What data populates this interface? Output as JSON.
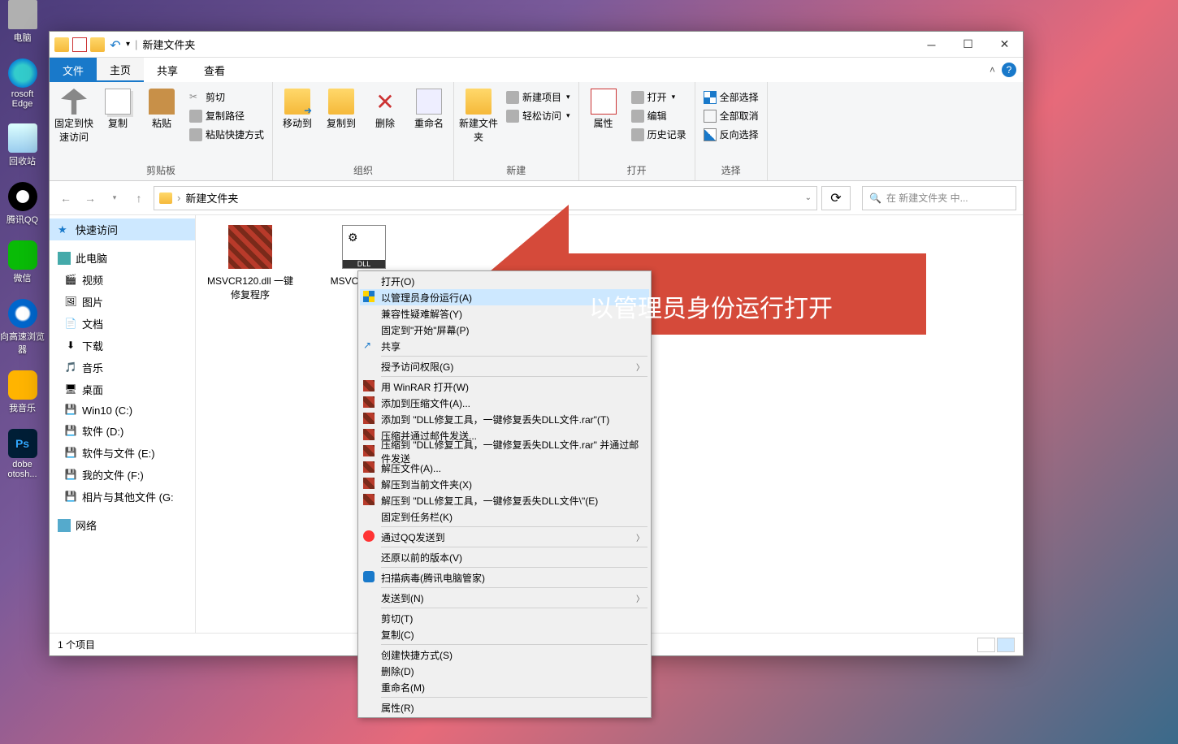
{
  "desktop": {
    "icons": [
      {
        "label": "电脑"
      },
      {
        "label": "rosoft Edge"
      },
      {
        "label": "回收站"
      },
      {
        "label": "腾讯QQ"
      },
      {
        "label": "微信"
      },
      {
        "label": "向高速浏览器"
      },
      {
        "label": "我音乐"
      },
      {
        "label": "dobe otosh..."
      }
    ]
  },
  "window": {
    "title": "新建文件夹",
    "ribbon": {
      "tabs": {
        "file": "文件",
        "home": "主页",
        "share": "共享",
        "view": "查看"
      },
      "clipboard": {
        "label": "剪贴板",
        "pin": "固定到快速访问",
        "copy": "复制",
        "paste": "粘贴",
        "cut": "剪切",
        "copy_path": "复制路径",
        "paste_shortcut": "粘贴快捷方式"
      },
      "organize": {
        "label": "组织",
        "move": "移动到",
        "copy_to": "复制到",
        "delete": "删除",
        "rename": "重命名"
      },
      "new": {
        "label": "新建",
        "new_folder": "新建文件夹",
        "new_item": "新建项目",
        "easy_access": "轻松访问"
      },
      "open": {
        "label": "打开",
        "props": "属性",
        "open": "打开",
        "edit": "编辑",
        "history": "历史记录"
      },
      "select": {
        "label": "选择",
        "all": "全部选择",
        "none": "全部取消",
        "invert": "反向选择"
      }
    },
    "breadcrumb": {
      "root": "",
      "name": "新建文件夹"
    },
    "search_placeholder": "在 新建文件夹 中...",
    "side": {
      "quick": "快速访问",
      "thispc": "此电脑",
      "items": [
        "视频",
        "图片",
        "文档",
        "下载",
        "音乐",
        "桌面",
        "Win10 (C:)",
        "软件 (D:)",
        "软件与文件 (E:)",
        "我的文件 (F:)",
        "相片与其他文件 (G:"
      ],
      "network": "网络"
    },
    "files": [
      {
        "name": "MSVCR120.dll 一键修复程序",
        "icon": "rar"
      },
      {
        "name": "MSVCR 一键修",
        "icon": "dll"
      }
    ],
    "status": "1 个项目"
  },
  "ctx": [
    {
      "t": "打开(O)"
    },
    {
      "t": "以管理员身份运行(A)",
      "hl": true,
      "icon": "shield"
    },
    {
      "t": "兼容性疑难解答(Y)"
    },
    {
      "t": "固定到\"开始\"屏幕(P)"
    },
    {
      "t": "共享",
      "icon": "share"
    },
    {
      "sep": true
    },
    {
      "t": "授予访问权限(G)",
      "sub": true
    },
    {
      "sep": true
    },
    {
      "t": "用 WinRAR 打开(W)",
      "icon": "rar"
    },
    {
      "t": "添加到压缩文件(A)...",
      "icon": "rar"
    },
    {
      "t": "添加到 \"DLL修复工具，一键修复丢失DLL文件.rar\"(T)",
      "icon": "rar"
    },
    {
      "t": "压缩并通过邮件发送...",
      "icon": "rar"
    },
    {
      "t": "压缩到 \"DLL修复工具，一键修复丢失DLL文件.rar\" 并通过邮件发送",
      "icon": "rar"
    },
    {
      "t": "解压文件(A)...",
      "icon": "rar"
    },
    {
      "t": "解压到当前文件夹(X)",
      "icon": "rar"
    },
    {
      "t": "解压到 \"DLL修复工具，一键修复丢失DLL文件\\\"(E)",
      "icon": "rar"
    },
    {
      "t": "固定到任务栏(K)"
    },
    {
      "sep": true
    },
    {
      "t": "通过QQ发送到",
      "icon": "qq",
      "sub": true
    },
    {
      "sep": true
    },
    {
      "t": "还原以前的版本(V)"
    },
    {
      "sep": true
    },
    {
      "t": "扫描病毒(腾讯电脑管家)",
      "icon": "av"
    },
    {
      "sep": true
    },
    {
      "t": "发送到(N)",
      "sub": true
    },
    {
      "sep": true
    },
    {
      "t": "剪切(T)"
    },
    {
      "t": "复制(C)"
    },
    {
      "sep": true
    },
    {
      "t": "创建快捷方式(S)"
    },
    {
      "t": "删除(D)"
    },
    {
      "t": "重命名(M)"
    },
    {
      "sep": true
    },
    {
      "t": "属性(R)"
    }
  ],
  "annotation": "以管理员身份运行打开"
}
